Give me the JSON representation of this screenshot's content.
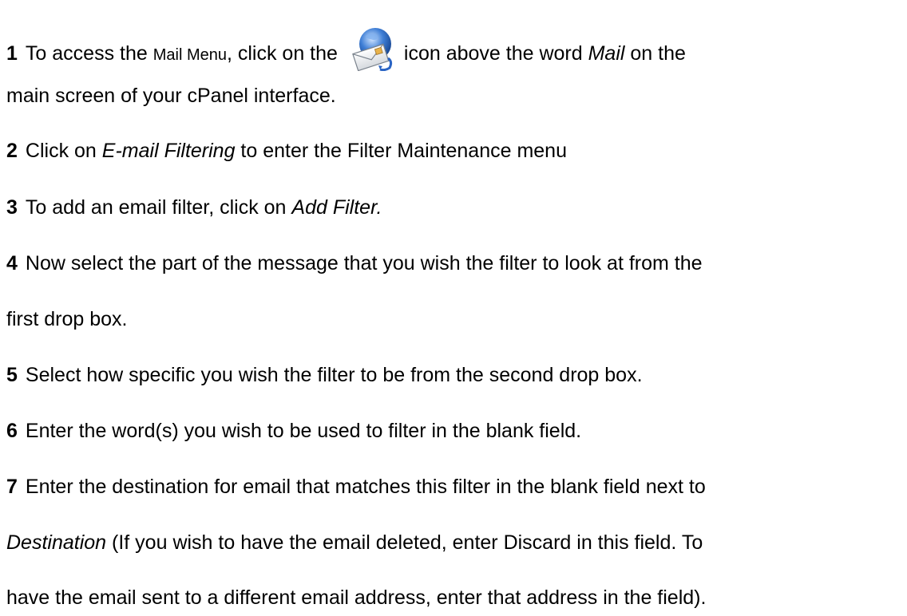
{
  "steps": [
    {
      "number": "1",
      "part1": "To access the ",
      "menu_name": "Mail Menu",
      "part2": ", click on the ",
      "icon": "cpanel-mail-icon",
      "part3": "icon above the word ",
      "mail_word": "Mail",
      "part4": " on the",
      "continuation": "main screen of your cPanel interface."
    },
    {
      "number": "2",
      "part1": "Click on ",
      "emph": "E-mail Filtering",
      "part2": " to enter the Filter Maintenance menu"
    },
    {
      "number": "3",
      "part1": "To add an email filter, click on ",
      "emph": "Add Filter."
    },
    {
      "number": "4",
      "part1": "Now select the part of the message that you wish the filter to look at from the",
      "continuation": "first drop box."
    },
    {
      "number": "5",
      "part1": "Select how specific you wish the filter to be from the second drop box."
    },
    {
      "number": "6",
      "part1": "Enter the word(s) you wish to be used to filter in the blank field."
    },
    {
      "number": "7",
      "part1": "Enter the destination for email that matches this filter in the blank field next to",
      "emph": "Destination",
      "part2": " (If you wish to have the email deleted, enter Discard in this field. To",
      "continuation": "have the email sent to a different email address, enter that address in the field)."
    }
  ]
}
